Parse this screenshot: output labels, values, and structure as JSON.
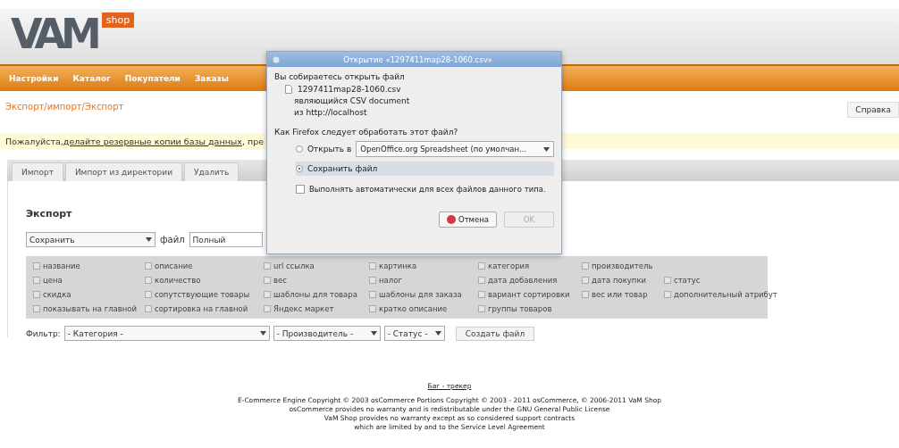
{
  "logo": {
    "text": "VAM",
    "badge": "shop"
  },
  "nav": [
    "Настройки",
    "Каталог",
    "Покупатели",
    "Заказы"
  ],
  "breadcrumb": "Экспорт/импорт/Экспорт",
  "help_button": "Справка",
  "notice": {
    "before": "Пожалуйста, ",
    "link": "делайте резервные копии базы данных",
    "after": ", пре"
  },
  "tabs": [
    {
      "label": "Импорт",
      "selected": false
    },
    {
      "label": "Импорт из директории",
      "selected": false
    },
    {
      "label": "Удалить",
      "selected": false
    }
  ],
  "export": {
    "heading": "Экспорт",
    "action_select": "Сохранить",
    "file_label": "файл",
    "file_value": "Полный",
    "fields": [
      [
        {
          "label": "название",
          "checked": false
        },
        {
          "label": "описание",
          "checked": false
        },
        {
          "label": "url ссылка",
          "checked": false
        },
        {
          "label": "картинка",
          "checked": false
        },
        {
          "label": "категория",
          "checked": false
        },
        {
          "label": "производитель",
          "checked": false
        }
      ],
      [
        {
          "label": "цена",
          "checked": false
        },
        {
          "label": "количество",
          "checked": false
        },
        {
          "label": "вес",
          "checked": false
        },
        {
          "label": "налог",
          "checked": false
        },
        {
          "label": "дата добавления",
          "checked": false
        },
        {
          "label": "дата покупки",
          "checked": false
        },
        {
          "label": "статус",
          "checked": false
        }
      ],
      [
        {
          "label": "скидка",
          "checked": false
        },
        {
          "label": "сопутствующие товары",
          "checked": false
        },
        {
          "label": "шаблоны для товара",
          "checked": false
        },
        {
          "label": "шаблоны для заказа",
          "checked": false
        },
        {
          "label": "вариант сортировки",
          "checked": false
        },
        {
          "label": "вес или товар",
          "checked": false
        },
        {
          "label": "дополнительный атрибут",
          "checked": false
        }
      ],
      [
        {
          "label": "показывать на главной",
          "checked": false
        },
        {
          "label": "сортировка на главной",
          "checked": false
        },
        {
          "label": "Яндекс маркет",
          "checked": false
        },
        {
          "label": "кратко описание",
          "checked": false
        },
        {
          "label": "группы товаров",
          "checked": false
        }
      ]
    ],
    "filter": {
      "label": "Фильтр:",
      "selects": [
        "- Категория -",
        "- Производитель -",
        "- Статус -"
      ],
      "button": "Создать файл"
    }
  },
  "footer": {
    "link": "Баг - трекер",
    "lines": [
      "E-Commerce Engine Copyright © 2003 osCommerce Portions Copyright © 2003 - 2011 osCommerce, © 2006-2011 VaM Shop",
      "osCommerce provides no warranty and is redistributable under the GNU General Public License",
      "VaM Shop provides no warranty except as so considered support contracts",
      "which are limited by and to the Service Level Agreement"
    ]
  },
  "dialog": {
    "title": "Открытие «1297411map28-1060.csv»",
    "intro": "Вы собираетесь открыть файл",
    "file_name": "1297411map28-1060.csv",
    "file_type": "являющийся  CSV document",
    "file_source": "из http://localhost",
    "question": "Как Firefox следует обработать этот файл?",
    "options": [
      {
        "label": "Открыть в",
        "selected": false,
        "app": "OpenOffice.org Spreadsheet (по умолчан..."
      },
      {
        "label": "Сохранить файл",
        "selected": true
      }
    ],
    "remember": {
      "label": "Выполнять автоматически для всех файлов данного типа.",
      "checked": false
    },
    "buttons": [
      {
        "label": "Отмена",
        "disabled": false
      },
      {
        "label": "OK",
        "disabled": true
      }
    ]
  }
}
